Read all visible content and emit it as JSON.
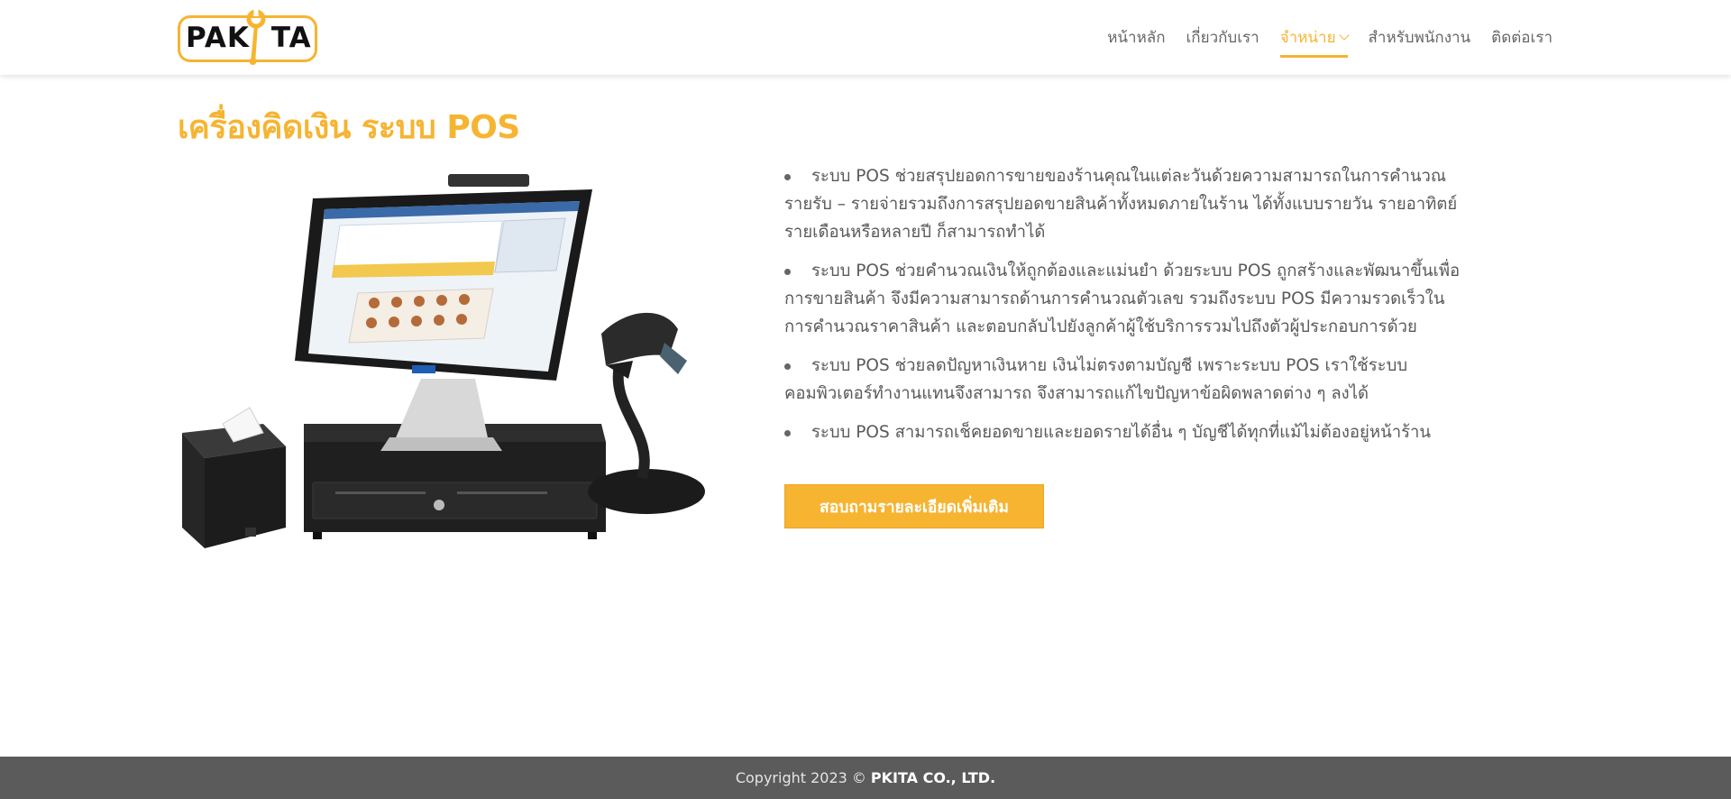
{
  "brand": {
    "logo_left": "PAK",
    "logo_right": "TA",
    "accent": "#F6B431"
  },
  "nav": {
    "items": [
      {
        "label": "หน้าหลัก",
        "active": false
      },
      {
        "label": "เกี่ยวกับเรา",
        "active": false
      },
      {
        "label": "จำหน่าย",
        "active": true,
        "has_dropdown": true
      },
      {
        "label": "สำหรับพนักงาน",
        "active": false
      },
      {
        "label": "ติดต่อเรา",
        "active": false
      }
    ]
  },
  "main": {
    "title": "เครื่องคิดเงิน ระบบ POS",
    "bullets": [
      "ระบบ POS ช่วยสรุปยอดการขายของร้านคุณในแต่ละวันด้วยความสามารถในการคำนวณรายรับ – รายจ่ายรวมถึงการสรุปยอดขายสินค้าทั้งหมดภายในร้าน ได้ทั้งแบบรายวัน รายอาทิตย์ รายเดือนหรือหลายปี ก็สามารถทำได้",
      "ระบบ POS ช่วยคำนวณเงินให้ถูกต้องและแม่นยำ ด้วยระบบ POS ถูกสร้างและพัฒนาขึ้นเพื่อการขายสินค้า จึงมีความสามารถด้านการคำนวณตัวเลข รวมถึงระบบ POS มีความรวดเร็วในการคำนวณราคาสินค้า และตอบกลับไปยังลูกค้าผู้ใช้บริการรวมไปถึงตัวผู้ประกอบการด้วย",
      "ระบบ POS ช่วยลดปัญหาเงินหาย เงินไม่ตรงตามบัญชี เพราะระบบ POS เราใช้ระบบคอมพิวเตอร์ทำงานแทนจึงสามารถ จึงสามารถแก้ไขปัญหาข้อผิดพลาดต่าง ๆ ลงได้",
      "ระบบ POS สามารถเช็คยอดขายและยอดรายได้อื่น ๆ บัญชีได้ทุกที่แม้ไม่ต้องอยู่หน้าร้าน"
    ],
    "cta_label": "สอบถามรายละเอียดเพิ่มเติม"
  },
  "footer": {
    "copyright": "Copyright 2023 ©",
    "company": "PKITA CO., LTD."
  }
}
